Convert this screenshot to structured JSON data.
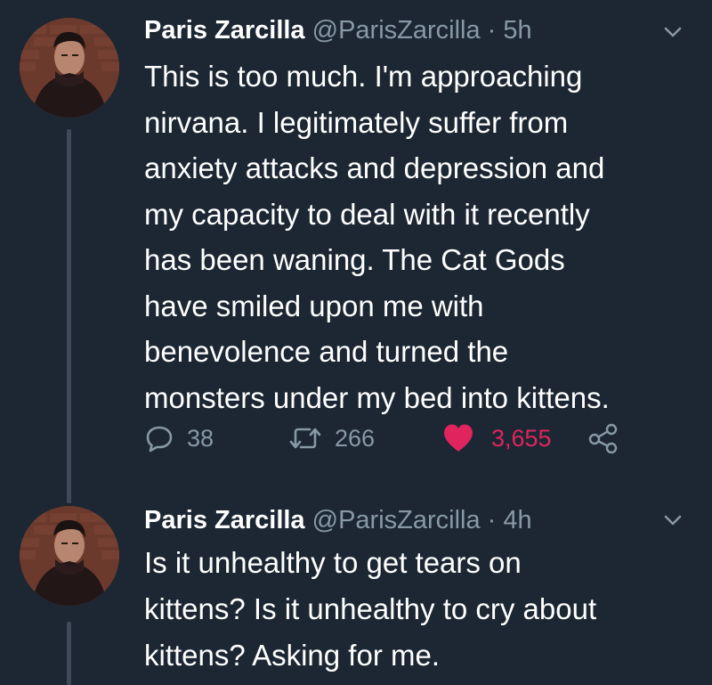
{
  "tweets": [
    {
      "display_name": "Paris Zarcilla",
      "handle": "@ParisZarcilla",
      "separator": "·",
      "time": "5h",
      "text": "This is too much. I'm approaching\nnirvana. I legitimately suffer from\nanxiety attacks and depression and\nmy capacity to deal with it recently\nhas been waning. The Cat Gods\nhave smiled upon me with\nbenevolence and turned the\nmonsters under my bed into kittens.",
      "replies": "38",
      "retweets": "266",
      "likes": "3,655",
      "liked": true
    },
    {
      "display_name": "Paris Zarcilla",
      "handle": "@ParisZarcilla",
      "separator": "·",
      "time": "4h",
      "text": "Is it unhealthy to get tears on\nkittens? Is it unhealthy to cry about\nkittens? Asking for me."
    }
  ],
  "colors": {
    "background": "#1c2733",
    "secondary_text": "#8899a6",
    "like_active": "#e0245e",
    "thread_line": "#3d4b59"
  },
  "icons": {
    "reply": "reply-bubble-icon",
    "retweet": "retweet-icon",
    "like": "heart-icon",
    "share": "share-icon",
    "menu": "chevron-down-icon"
  }
}
